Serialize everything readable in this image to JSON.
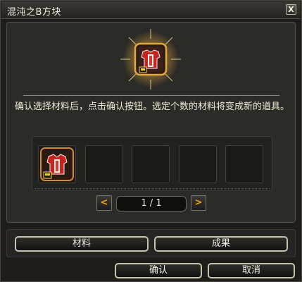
{
  "window": {
    "title": "混沌之B方块",
    "close_label": "X"
  },
  "instruction": "确认选择材料后，点击确认按钮。选定个数的材料将变成新的道具。",
  "slots": {
    "count": 5,
    "filled": [
      true,
      false,
      false,
      false,
      false
    ]
  },
  "pager": {
    "prev_label": "<",
    "next_label": ">",
    "page_text": "1 / 1"
  },
  "tabs": {
    "materials_label": "材料",
    "result_label": "成果"
  },
  "actions": {
    "confirm_label": "确认",
    "cancel_label": "取消"
  },
  "icons": {
    "result_item": "armor-chest-icon",
    "material_item": "armor-chest-icon"
  },
  "colors": {
    "accent": "#f0a020",
    "glow": "#ffdc6a",
    "item_red": "#c7241f"
  }
}
